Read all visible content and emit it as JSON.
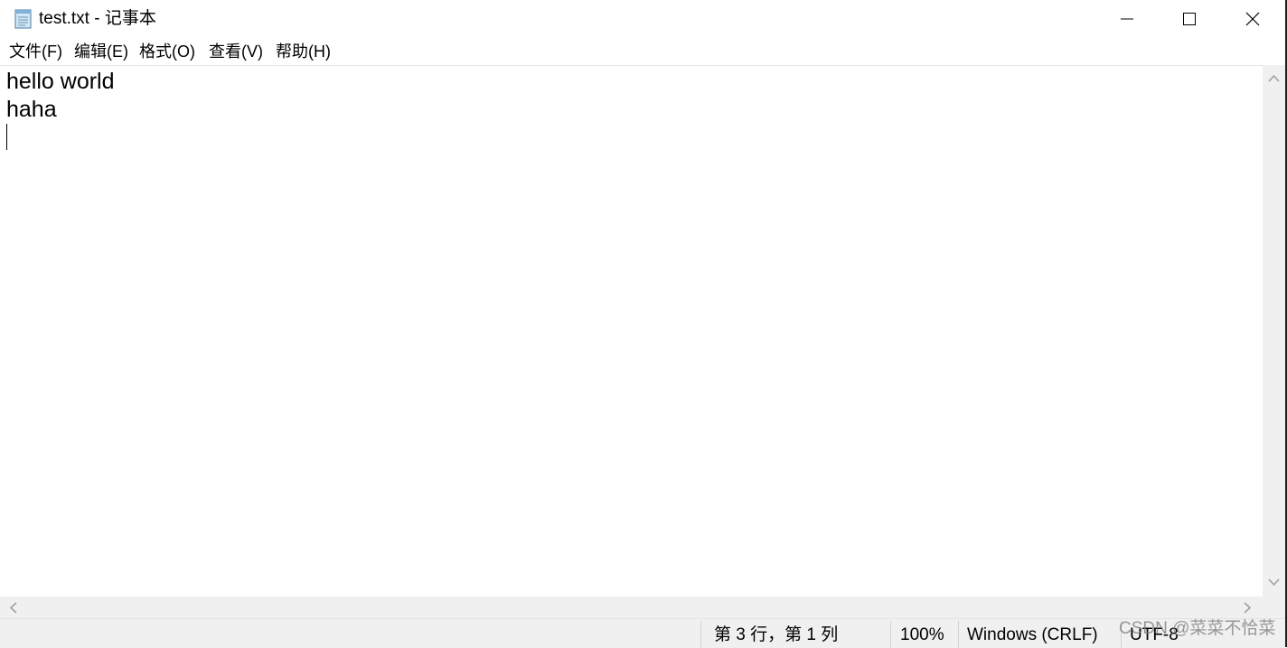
{
  "window": {
    "title": "test.txt - 记事本"
  },
  "menu": {
    "items": [
      {
        "label": "文件(F)"
      },
      {
        "label": "编辑(E)"
      },
      {
        "label": "格式(O)"
      },
      {
        "label": "查看(V)"
      },
      {
        "label": "帮助(H)"
      }
    ]
  },
  "editor": {
    "lines": [
      "hello world",
      "haha",
      ""
    ]
  },
  "status": {
    "position": "第 3 行，第 1 列",
    "zoom": "100%",
    "line_ending": "Windows (CRLF)",
    "encoding": "UTF-8"
  },
  "watermark": "CSDN @菜菜不恰菜",
  "icons": {
    "app": "notepad-icon",
    "minimize": "minimize-icon",
    "maximize": "maximize-icon",
    "close": "close-icon"
  }
}
